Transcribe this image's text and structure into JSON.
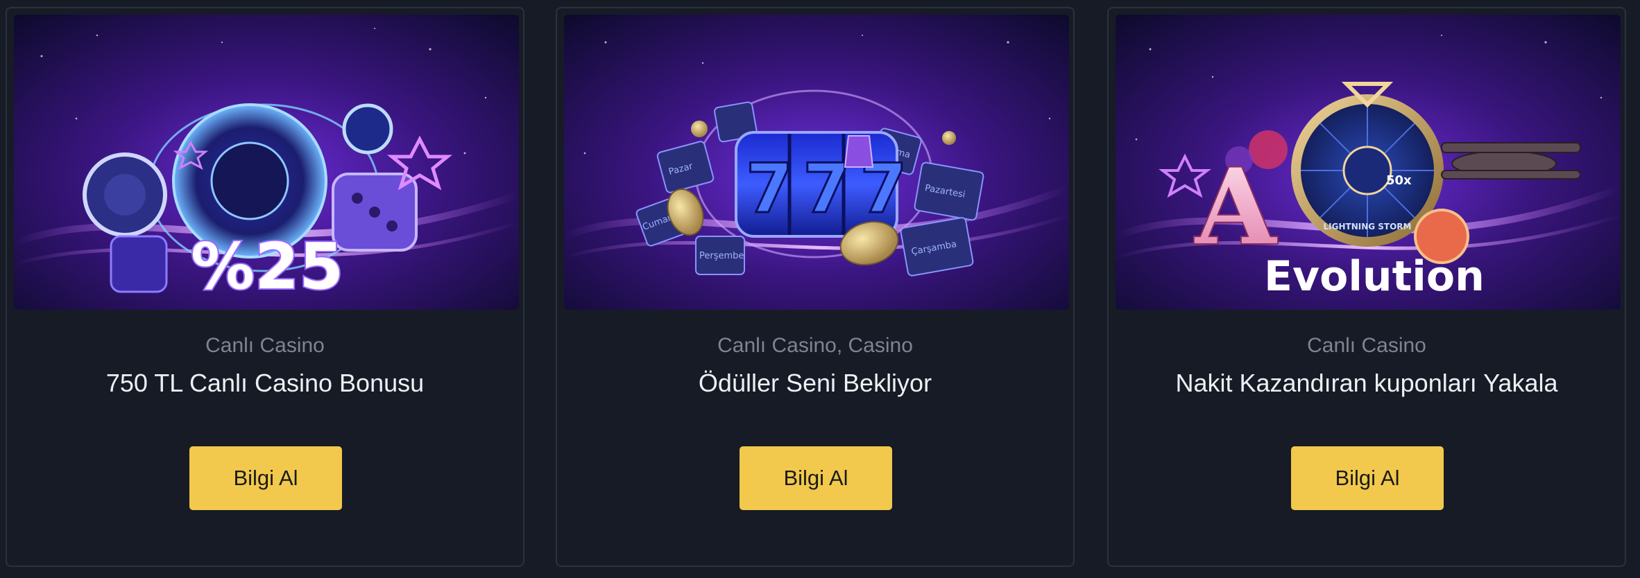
{
  "accent_color": "#f2c94c",
  "cards": [
    {
      "category": "Canlı Casino",
      "title": "750 TL Canlı Casino Bonusu",
      "button_label": "Bilgi Al",
      "banner_text": "%25"
    },
    {
      "category": "Canlı Casino, Casino",
      "title": "Ödüller Seni Bekliyor",
      "button_label": "Bilgi Al",
      "banner_text": "777",
      "banner_days": [
        "Pazar",
        "Pazartesi",
        "Çarşamba",
        "Perşembe",
        "Cumartesi",
        "Cuma"
      ]
    },
    {
      "category": "Canlı Casino",
      "title": "Nakit Kazandıran kuponları Yakala",
      "button_label": "Bilgi Al",
      "banner_text": "Evolution",
      "banner_badge": "LIGHTNING STORM",
      "banner_multiplier": "50x"
    }
  ]
}
